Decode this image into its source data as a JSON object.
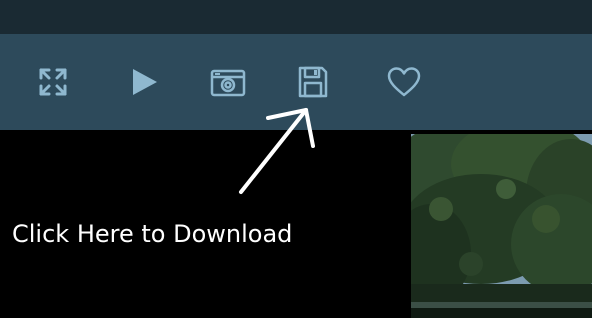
{
  "toolbar": {
    "icons": [
      {
        "name": "fullscreen-icon"
      },
      {
        "name": "play-icon"
      },
      {
        "name": "snapshot-icon"
      },
      {
        "name": "save-icon"
      },
      {
        "name": "favorite-icon"
      }
    ],
    "icon_color": "#8fb8cf",
    "background": "#2d4a5b"
  },
  "top_bar": {
    "background": "#1a2a33"
  },
  "annotation": {
    "text": "Click Here to Download",
    "color": "#ffffff"
  },
  "thumbnail": {
    "subject": "trees"
  }
}
